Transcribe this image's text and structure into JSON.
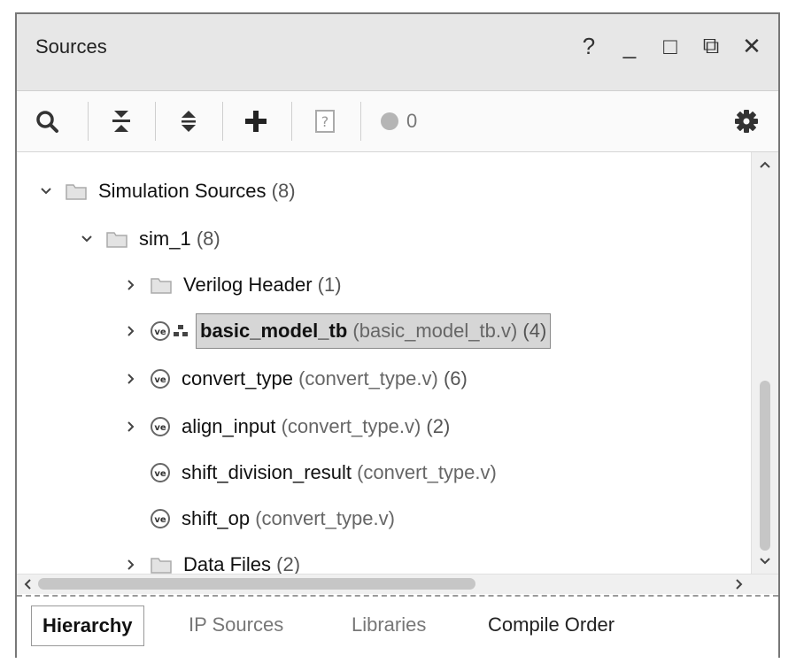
{
  "panel": {
    "title": "Sources",
    "controls": [
      {
        "name": "help-icon",
        "glyph": "?"
      },
      {
        "name": "minimize-icon",
        "glyph": "_"
      },
      {
        "name": "maximize-icon",
        "glyph": "□"
      },
      {
        "name": "float-icon",
        "glyph": "⧉"
      },
      {
        "name": "close-icon",
        "glyph": "✕"
      }
    ]
  },
  "toolbar": {
    "message_count": "0"
  },
  "tree": {
    "root": {
      "label": "Simulation Sources",
      "count": "(8)"
    },
    "sim": {
      "label": "sim_1",
      "count": "(8)"
    },
    "items": [
      {
        "label": "Verilog Header",
        "file": "",
        "count": "(1)"
      },
      {
        "label": "basic_model_tb",
        "file": "(basic_model_tb.v)",
        "count": "(4)"
      },
      {
        "label": "convert_type",
        "file": "(convert_type.v)",
        "count": "(6)"
      },
      {
        "label": "align_input",
        "file": "(convert_type.v)",
        "count": "(2)"
      },
      {
        "label": "shift_division_result",
        "file": "(convert_type.v)",
        "count": ""
      },
      {
        "label": "shift_op",
        "file": "(convert_type.v)",
        "count": ""
      },
      {
        "label": "Data Files",
        "file": "",
        "count": "(2)"
      }
    ]
  },
  "tabs": [
    {
      "label": "Hierarchy"
    },
    {
      "label": "IP Sources"
    },
    {
      "label": "Libraries"
    },
    {
      "label": "Compile Order"
    }
  ]
}
